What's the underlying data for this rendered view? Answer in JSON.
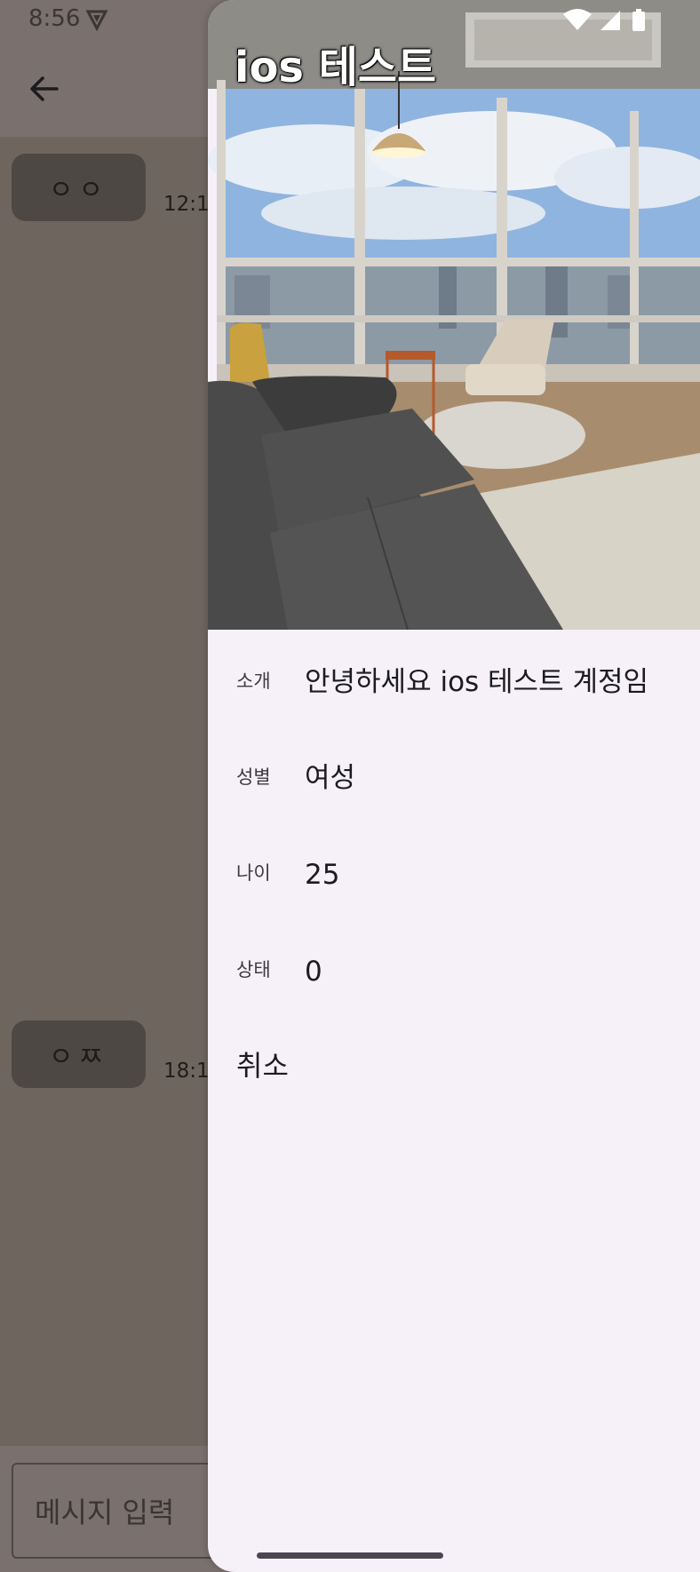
{
  "status_bar": {
    "time": "8:56",
    "icons": [
      "vpn-shield-icon",
      "wifi-icon",
      "cellular-icon",
      "battery-icon"
    ]
  },
  "chat": {
    "back_icon": "arrow-back-icon",
    "messages": [
      {
        "text": "ㅇㅇ",
        "time": "12:1"
      },
      {
        "text": "ㅇㅉ",
        "time": "18:1"
      }
    ],
    "input_placeholder": "메시지 입력"
  },
  "profile": {
    "name": "ios 테스트",
    "photo": "living-room-photo",
    "fields": [
      {
        "label": "소개",
        "value": "안녕하세요 ios 테스트 계정임"
      },
      {
        "label": "성별",
        "value": "여성"
      },
      {
        "label": "나이",
        "value": "25"
      },
      {
        "label": "상태",
        "value": "0"
      }
    ],
    "cancel_label": "취소"
  },
  "colors": {
    "scrim": "#6f655f",
    "drawer_bg": "#f6f1f8",
    "bubble_bg": "#4d4844"
  }
}
